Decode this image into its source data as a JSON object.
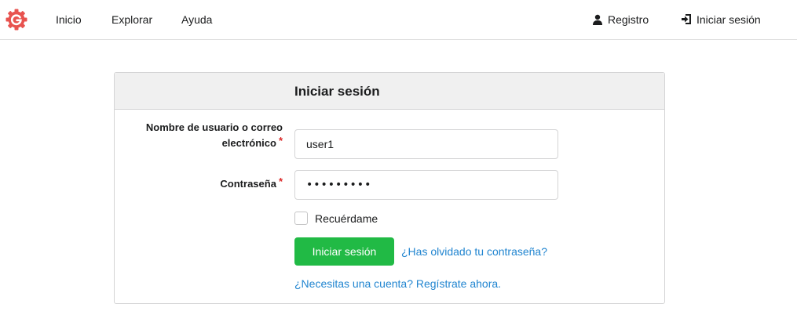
{
  "nav": {
    "home": "Inicio",
    "explore": "Explorar",
    "help": "Ayuda",
    "register": "Registro",
    "signin": "Iniciar sesión"
  },
  "login": {
    "title": "Iniciar sesión",
    "username_label": "Nombre de usuario o correo",
    "username_label_2": "electrónico",
    "username_value": "user1",
    "password_label": "Contraseña",
    "password_value": "123456789",
    "required_mark": "*",
    "remember_label": "Recuérdame",
    "remember_checked": false,
    "submit_label": "Iniciar sesión",
    "forgot_link": "¿Has olvidado tu contraseña?",
    "signup_link": "¿Necesitas una cuenta? Regístrate ahora."
  },
  "colors": {
    "brand": "#e8534f",
    "primary_button": "#21ba45",
    "link": "#2185d0",
    "required": "#db2828"
  },
  "icons": {
    "logo": "gitea-logo",
    "register": "user-icon",
    "signin": "sign-in-icon"
  }
}
